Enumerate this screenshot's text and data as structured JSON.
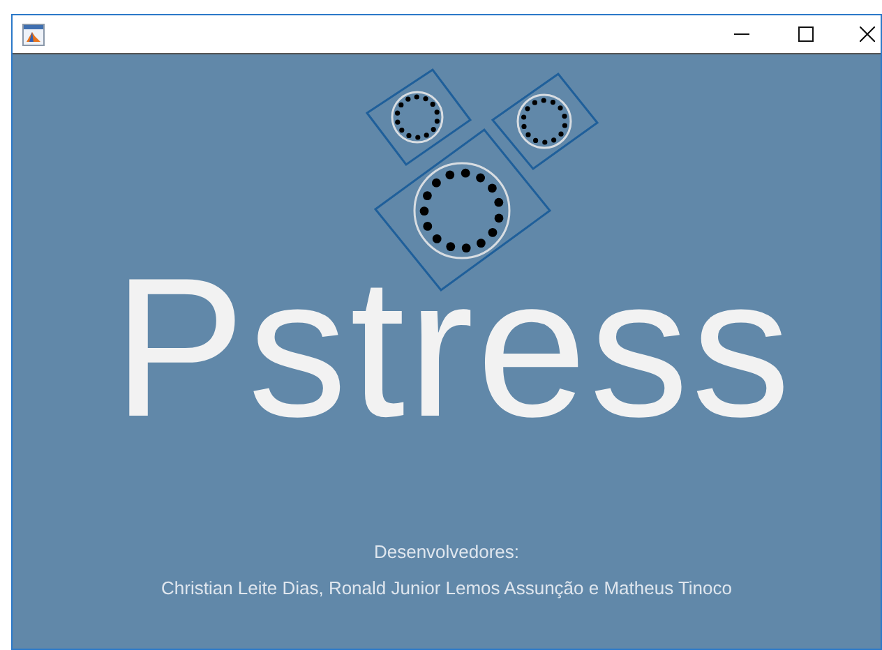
{
  "app_title": "Pstress",
  "credits": {
    "heading": "Desenvolvedores:",
    "names": "Christian Leite Dias, Ronald Junior Lemos Assunção e Matheus Tinoco"
  }
}
